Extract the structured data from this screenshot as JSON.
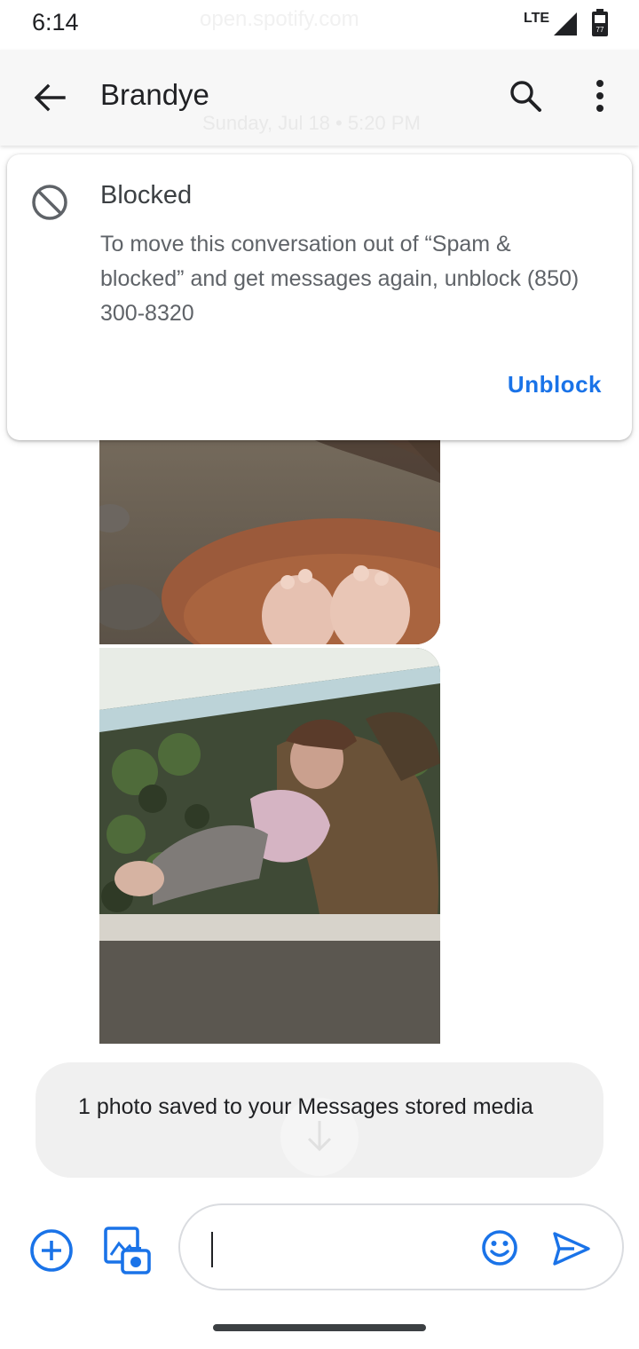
{
  "status_bar": {
    "time": "6:14",
    "network": "LTE",
    "background_url": "open.spotify.com",
    "icons": [
      "signal-icon",
      "battery-icon"
    ]
  },
  "app_bar": {
    "title": "Brandye",
    "background_date": "Sunday, Jul 18 • 5:20 PM",
    "icons": [
      "back-arrow-icon",
      "search-icon",
      "more-vert-icon"
    ]
  },
  "blocked_banner": {
    "title": "Blocked",
    "body": "To move this conversation out of “Spam & blocked” and get messages again, unblock (850) 300-8320",
    "action_label": "Unblock",
    "icon": "block-icon"
  },
  "messages": {
    "items": [
      {
        "type": "photo",
        "icon": "photo-dog-feet"
      },
      {
        "type": "photo",
        "icon": "photo-woman-dog"
      }
    ]
  },
  "toast": {
    "text": "1 photo saved to your Messages stored media",
    "icon": "download-icon"
  },
  "compose": {
    "value": "",
    "placeholder": "",
    "icons": [
      "add-circle-icon",
      "gallery-camera-icon",
      "emoji-icon",
      "send-icon"
    ]
  },
  "colors": {
    "accent": "#1a73e8",
    "app_bar_bg": "#f7f7f7",
    "toast_bg": "#f0f0f0",
    "text_primary": "#202124",
    "text_secondary": "#5f6368"
  }
}
